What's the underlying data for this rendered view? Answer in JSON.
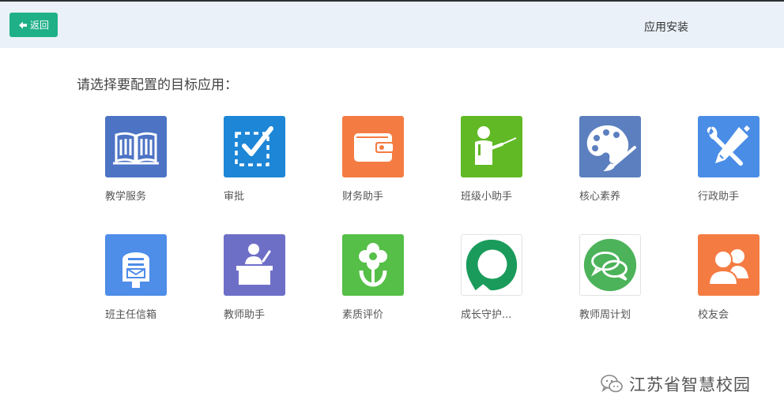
{
  "header": {
    "back_label": "返回",
    "title": "应用安装"
  },
  "prompt": "请选择要配置的目标应用：",
  "apps": [
    {
      "label": "教学服务",
      "icon": "book-icon",
      "color": "#4d73c4"
    },
    {
      "label": "审批",
      "icon": "approval-check-icon",
      "color": "#1d86d6"
    },
    {
      "label": "财务助手",
      "icon": "wallet-icon",
      "color": "#f47c43"
    },
    {
      "label": "班级小助手",
      "icon": "teacher-board-icon",
      "color": "#61b925"
    },
    {
      "label": "核心素养",
      "icon": "palette-icon",
      "color": "#5b7fbf"
    },
    {
      "label": "行政助手",
      "icon": "tools-icon",
      "color": "#4a8de6"
    },
    {
      "label": "班主任信箱",
      "icon": "mailbox-icon",
      "color": "#4e8de8"
    },
    {
      "label": "教师助手",
      "icon": "teacher-desk-icon",
      "color": "#6d6fc7"
    },
    {
      "label": "素质评价",
      "icon": "flower-icon",
      "color": "#55bf47"
    },
    {
      "label": "成长守护...",
      "icon": "chat-ring-icon",
      "color": "#1a9b5b"
    },
    {
      "label": "教师周计划",
      "icon": "chat-bubbles-icon",
      "color": "#4cb35a"
    },
    {
      "label": "校友会",
      "icon": "users-icon",
      "color": "#f47c43"
    }
  ],
  "watermark": {
    "text": "江苏省智慧校园",
    "icon": "wechat-icon"
  }
}
